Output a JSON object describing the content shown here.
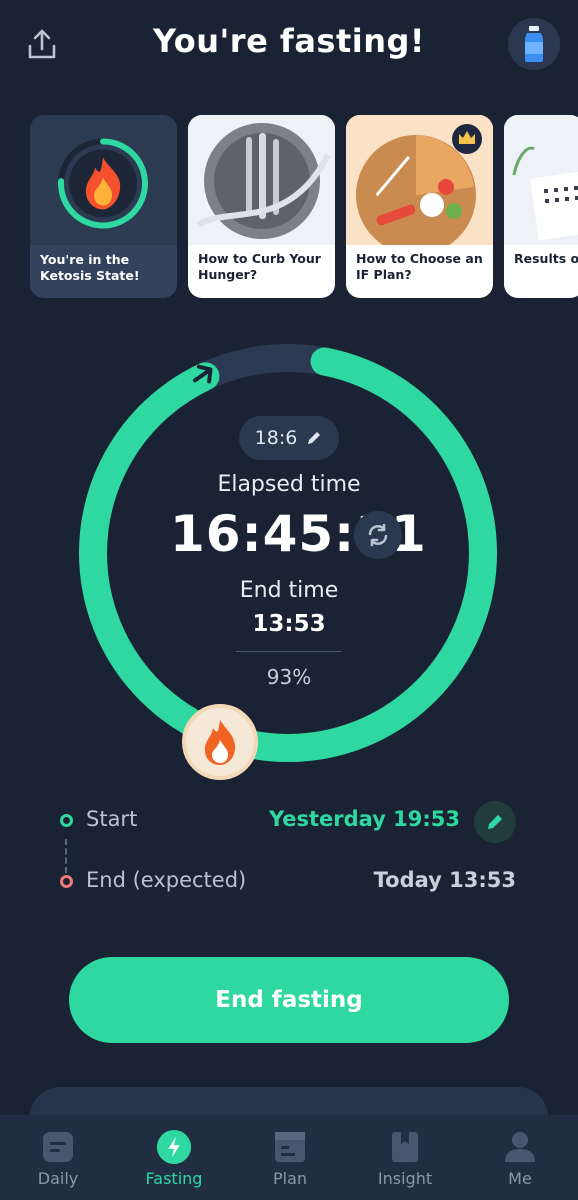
{
  "header": {
    "title": "You're fasting!",
    "share_icon": "share-icon",
    "water_icon": "water-bottle-icon"
  },
  "cards": [
    {
      "caption": "You're in the Ketosis State!",
      "icon": "flame-icon"
    },
    {
      "caption": "How to Curb Your Hunger?",
      "icon": "plate-cutlery-image"
    },
    {
      "caption": "How to Choose an IF Plan?",
      "icon": "food-plate-image",
      "badge": "crown-icon"
    },
    {
      "caption": "Results of Fast",
      "icon": "calendar-image"
    }
  ],
  "timer": {
    "plan": "18:6",
    "elapsed_label": "Elapsed time",
    "elapsed_value": "16:45:11",
    "end_label": "End time",
    "end_value": "13:53",
    "percent": "93%",
    "progress": 0.93
  },
  "timeline": {
    "start_label": "Start",
    "start_value": "Yesterday 19:53",
    "end_label": "End (expected)",
    "end_value": "Today 13:53"
  },
  "end_button": "End fasting",
  "nav": [
    {
      "label": "Daily",
      "icon": "daily-icon",
      "active": false
    },
    {
      "label": "Fasting",
      "icon": "fasting-icon",
      "active": true
    },
    {
      "label": "Plan",
      "icon": "plan-icon",
      "active": false
    },
    {
      "label": "Insight",
      "icon": "insight-icon",
      "active": false
    },
    {
      "label": "Me",
      "icon": "profile-icon",
      "active": false
    }
  ],
  "colors": {
    "background": "#1a2334",
    "accent": "#2fd8a0",
    "ring_track": "#2b3a52",
    "end_dot": "#f07b7b"
  }
}
